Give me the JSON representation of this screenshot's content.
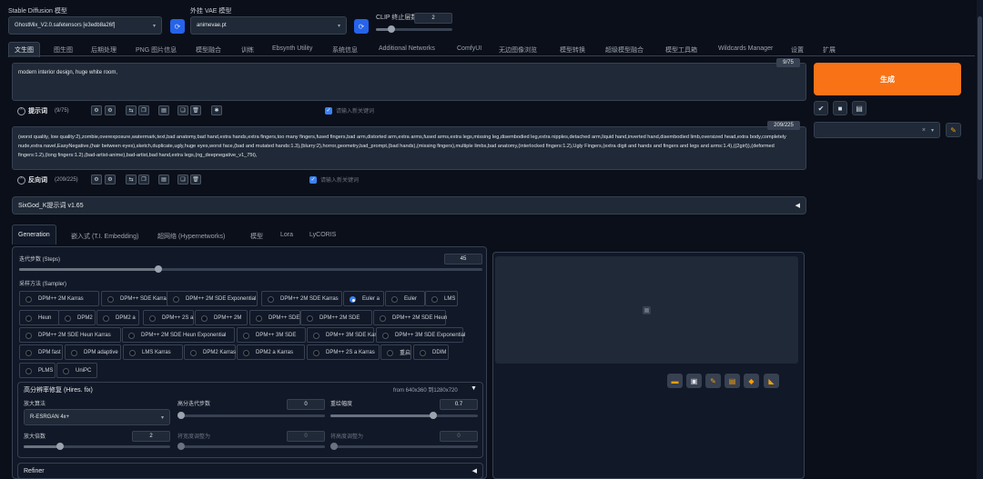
{
  "top": {
    "model_label": "Stable Diffusion 模型",
    "model_value": "GhostMix_V2.0.safetensors [e3edb8a26f]",
    "vae_label": "外挂 VAE 模型",
    "vae_value": "animevae.pt",
    "clip_label": "CLIP 终止层数",
    "clip_value": "2",
    "clip_fraction": 0.2
  },
  "tabs": [
    "文生图",
    "图生图",
    "后期处理",
    "PNG 图片信息",
    "模型融合",
    "训练",
    "Ebsynth Utility",
    "系统信息",
    "Additional Networks",
    "ComfyUI",
    "无边图像浏览",
    "模型转换",
    "超级模型融合",
    "模型工具箱",
    "Wildcards Manager",
    "设置",
    "扩展"
  ],
  "prompt": {
    "text": "modern interior design, huge white room,",
    "counter": "9/75",
    "label": "提示词",
    "label_count": "(9/75)",
    "search_placeholder": "请输入新关键词"
  },
  "negative": {
    "text": "(worst quality, low quality:2),zombie,overexposure,watermark,text,bad anatomy,bad hand,extra hands,extra fingers,too many fingers,fused fingers,bad arm,distorted arm,extra arms,fused arms,extra legs,missing leg,disembodied leg,extra nipples,detached arm,liquid hand,inverted hand,disembodied limb,oversized head,extra body,completely nude,extra navel,EasyNegative,(hair between eyes),sketch,duplicate,ugly,huge eyes,worst face,(bad and mutated hands:1.3),(blurry:2),horror,geometry,bad_prompt,(bad hands),(missing fingers),multiple limbs,bad anatomy,(interlocked fingers:1.2),Ugly Fingers,(extra digit and hands and fingers and legs and arms:1.4),((2girl)),(deformed fingers:1.2),(long fingers:1.2),(bad-artist-anime),bad-artist,bad hand,extra legs,(ng_deepnegative_v1_75t),",
    "counter": "209/225",
    "label": "反向词",
    "label_count": "(209/225)",
    "search_placeholder": "请输入新关键词"
  },
  "generate_label": "生成",
  "style_arrow": "×",
  "accordion": {
    "title": "SixGod_K提示词 v1.65"
  },
  "subtabs": [
    "Generation",
    "嵌入式 (T.I. Embedding)",
    "超网络 (Hypernetworks)",
    "模型",
    "Lora",
    "LyCORIS"
  ],
  "steps": {
    "label": "迭代步数 (Steps)",
    "value": "45",
    "fraction": 0.3
  },
  "sampler": {
    "label": "采样方法 (Sampler)",
    "selected": "Euler a",
    "options": [
      "DPM++ 2M Karras",
      "DPM++ SDE Karras",
      "DPM++ 2M SDE Exponential",
      "DPM++ 2M SDE Karras",
      "Euler a",
      "Euler",
      "LMS",
      "Heun",
      "DPM2",
      "DPM2 a",
      "DPM++ 2S a",
      "DPM++ 2M",
      "DPM++ SDE",
      "DPM++ 2M SDE",
      "DPM++ 2M SDE Heun",
      "DPM++ 2M SDE Heun Karras",
      "DPM++ 2M SDE Heun Exponential",
      "DPM++ 3M SDE",
      "DPM++ 3M SDE Karras",
      "DPM++ 3M SDE Exponential",
      "DPM fast",
      "DPM adaptive",
      "LMS Karras",
      "DPM2 Karras",
      "DPM2 a Karras",
      "DPM++ 2S a Karras",
      "重启",
      "DDIM",
      "PLMS",
      "UniPC"
    ]
  },
  "hires": {
    "title": "高分辨率修复 (Hires. fix)",
    "size_info": "from 640x360 到1280x720",
    "upscaler_label": "放大算法",
    "upscaler_value": "R-ESRGAN 4x+",
    "hires_steps_label": "高分迭代步数",
    "hires_steps_value": "0",
    "denoise_label": "重绘幅度",
    "denoise_value": "0.7",
    "denoise_fraction": 0.7,
    "scale_label": "放大倍数",
    "scale_value": "2",
    "scale_fraction": 0.25,
    "width_label": "将宽度调整为",
    "width_value": "0",
    "height_label": "将高度调整为",
    "height_value": "0"
  },
  "refiner": {
    "title": "Refiner"
  },
  "toolbar_icons": [
    "folder-icon",
    "save-icon",
    "zip-icon",
    "send-to-img2img-icon",
    "send-to-inpaint-icon",
    "send-to-extras-icon"
  ],
  "colors": {
    "accent": "#f97316",
    "primary": "#3b82f6",
    "background": "#0b0f19"
  }
}
